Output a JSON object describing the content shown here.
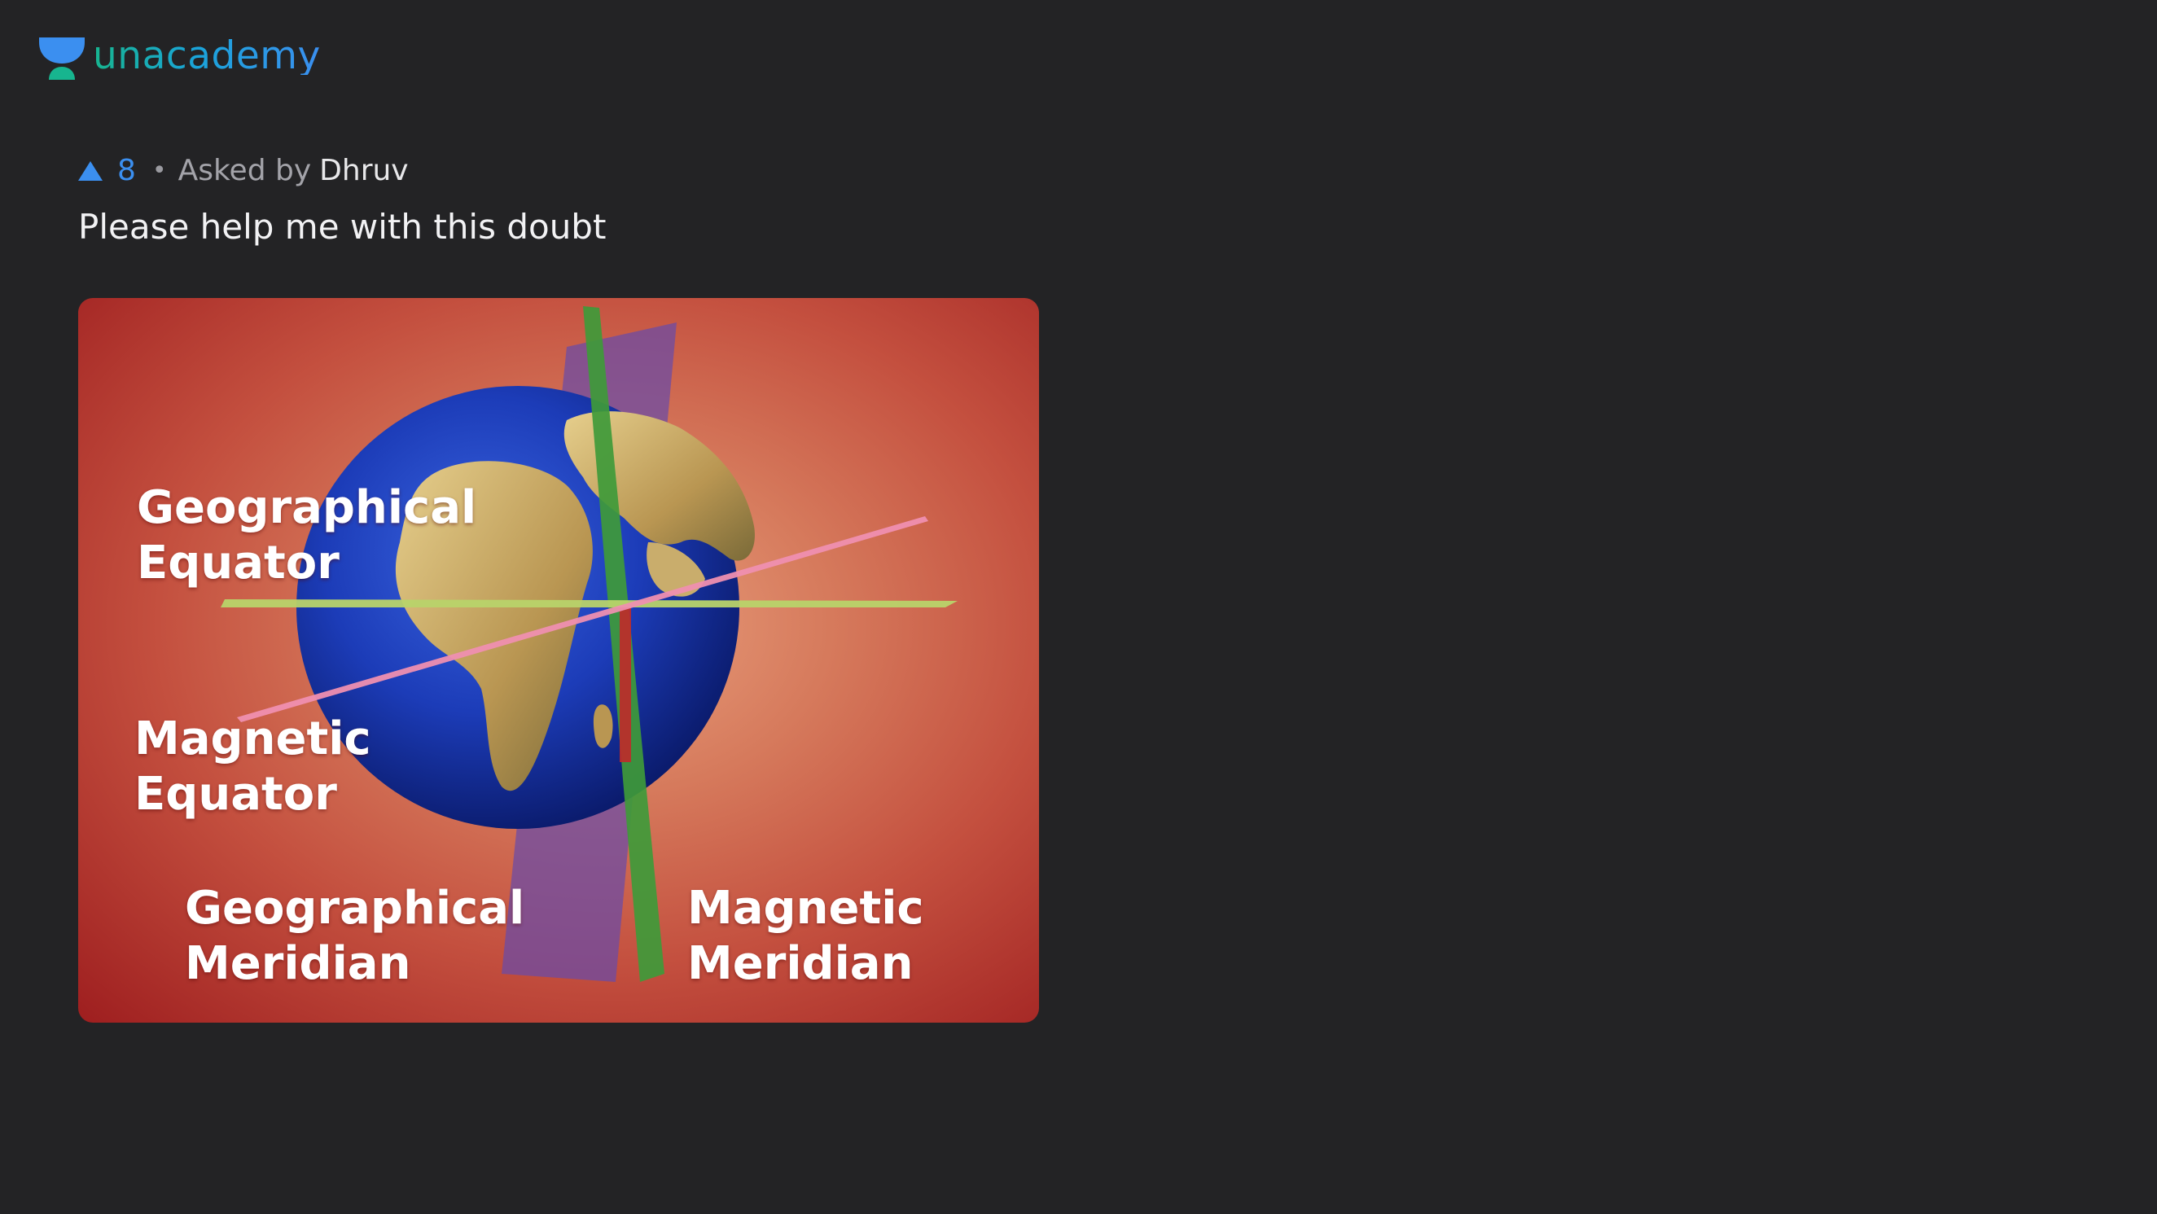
{
  "header": {
    "logo_text": "unacademy",
    "brand_colors": {
      "green": "#17b58f",
      "blue": "#3b8ff0"
    }
  },
  "question": {
    "upvote_icon": "triangle-up-icon",
    "upvotes": "8",
    "separator": "•",
    "asked_prefix": "Asked by",
    "author": "Dhruv",
    "text": "Please help me with this doubt"
  },
  "question_image": {
    "labels": {
      "geographical_equator": "Geographical\nEquator",
      "magnetic_equator": "Magnetic\nEquator",
      "geographical_meridian": "Geographical\nMeridian",
      "magnetic_meridian": "Magnetic\nMeridian"
    }
  }
}
